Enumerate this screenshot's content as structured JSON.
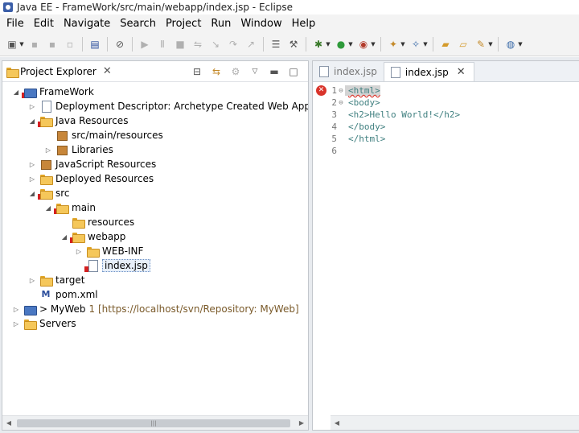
{
  "window": {
    "title": "Java EE - FrameWork/src/main/webapp/index.jsp - Eclipse"
  },
  "menu": [
    "File",
    "Edit",
    "Navigate",
    "Search",
    "Project",
    "Run",
    "Window",
    "Help"
  ],
  "project_explorer": {
    "tab_label": "Project Explorer",
    "tree": [
      {
        "label": "FrameWork"
      },
      {
        "label": "Deployment Descriptor: Archetype Created Web Applicati"
      },
      {
        "label": "Java Resources"
      },
      {
        "label": "src/main/resources"
      },
      {
        "label": "Libraries"
      },
      {
        "label": "JavaScript Resources"
      },
      {
        "label": "Deployed Resources"
      },
      {
        "label": "src"
      },
      {
        "label": "main"
      },
      {
        "label": "resources"
      },
      {
        "label": "webapp"
      },
      {
        "label": "WEB-INF"
      },
      {
        "label": "index.jsp"
      },
      {
        "label": "target"
      },
      {
        "label": "pom.xml"
      },
      {
        "label": "> MyWeb",
        "svn": "1 [https://localhost/svn/Repository: MyWeb]"
      },
      {
        "label": "Servers"
      }
    ]
  },
  "editor": {
    "tabs": [
      "index.jsp",
      "index.jsp"
    ],
    "lines": [
      {
        "num": "1",
        "code": "<html>"
      },
      {
        "num": "2",
        "code": "<body>"
      },
      {
        "num": "3",
        "code": "<h2>Hello World!</h2>"
      },
      {
        "num": "4",
        "code": "</body>"
      },
      {
        "num": "5",
        "code": "</html>"
      },
      {
        "num": "6",
        "code": ""
      }
    ]
  },
  "colors": {
    "tag": "#3f7f7f",
    "error": "#d9342b",
    "selection": "#e7eff9"
  }
}
